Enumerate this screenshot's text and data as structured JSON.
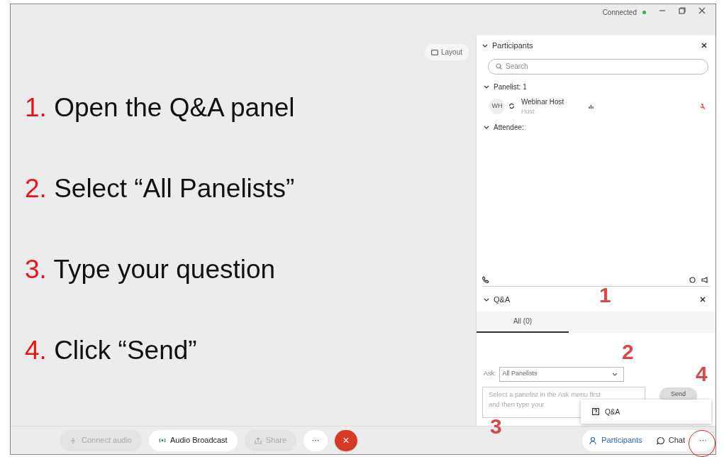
{
  "window": {
    "status": "Connected",
    "connected": true
  },
  "layout_button": "Layout",
  "instructions": [
    {
      "number": "1.",
      "text": "Open the Q&A panel"
    },
    {
      "number": "2.",
      "text": "Select “All Panelists”"
    },
    {
      "number": "3.",
      "text": "Type your question"
    },
    {
      "number": "4.",
      "text": "Click “Send”"
    }
  ],
  "participants": {
    "title": "Participants",
    "search_placeholder": "Search",
    "groups": [
      {
        "label": "Panelist: 1",
        "expanded": true,
        "members": [
          {
            "initials": "WH",
            "name": "Webinar Host",
            "role": "Host"
          }
        ]
      },
      {
        "label": "Attendee:",
        "expanded": true
      }
    ]
  },
  "qa": {
    "title": "Q&A",
    "tabs": [
      {
        "label": "All (0)",
        "selected": true
      }
    ],
    "ask_label": "Ask:",
    "ask_value": "All Panelists",
    "question_placeholder": "Select a panelist in the Ask menu first and then type your",
    "send": "Send"
  },
  "menu_popup": {
    "items": [
      {
        "label": "Q&A"
      }
    ]
  },
  "annotations": [
    "1",
    "2",
    "3",
    "4"
  ],
  "bottom_bar": {
    "controls": [
      {
        "kind": "audio",
        "label": "Connect audio",
        "disabled": true
      },
      {
        "kind": "broadcast",
        "label": "Audio Broadcast",
        "disabled": false
      },
      {
        "kind": "share",
        "label": "Share",
        "disabled": true
      },
      {
        "kind": "more",
        "label": "···",
        "disabled": false
      },
      {
        "kind": "end",
        "label": "×",
        "disabled": false
      }
    ],
    "panels": [
      {
        "kind": "participants",
        "label": "Participants",
        "selected": true
      },
      {
        "kind": "chat",
        "label": "Chat",
        "selected": false
      },
      {
        "kind": "more",
        "label": "···",
        "selected": false
      }
    ]
  }
}
